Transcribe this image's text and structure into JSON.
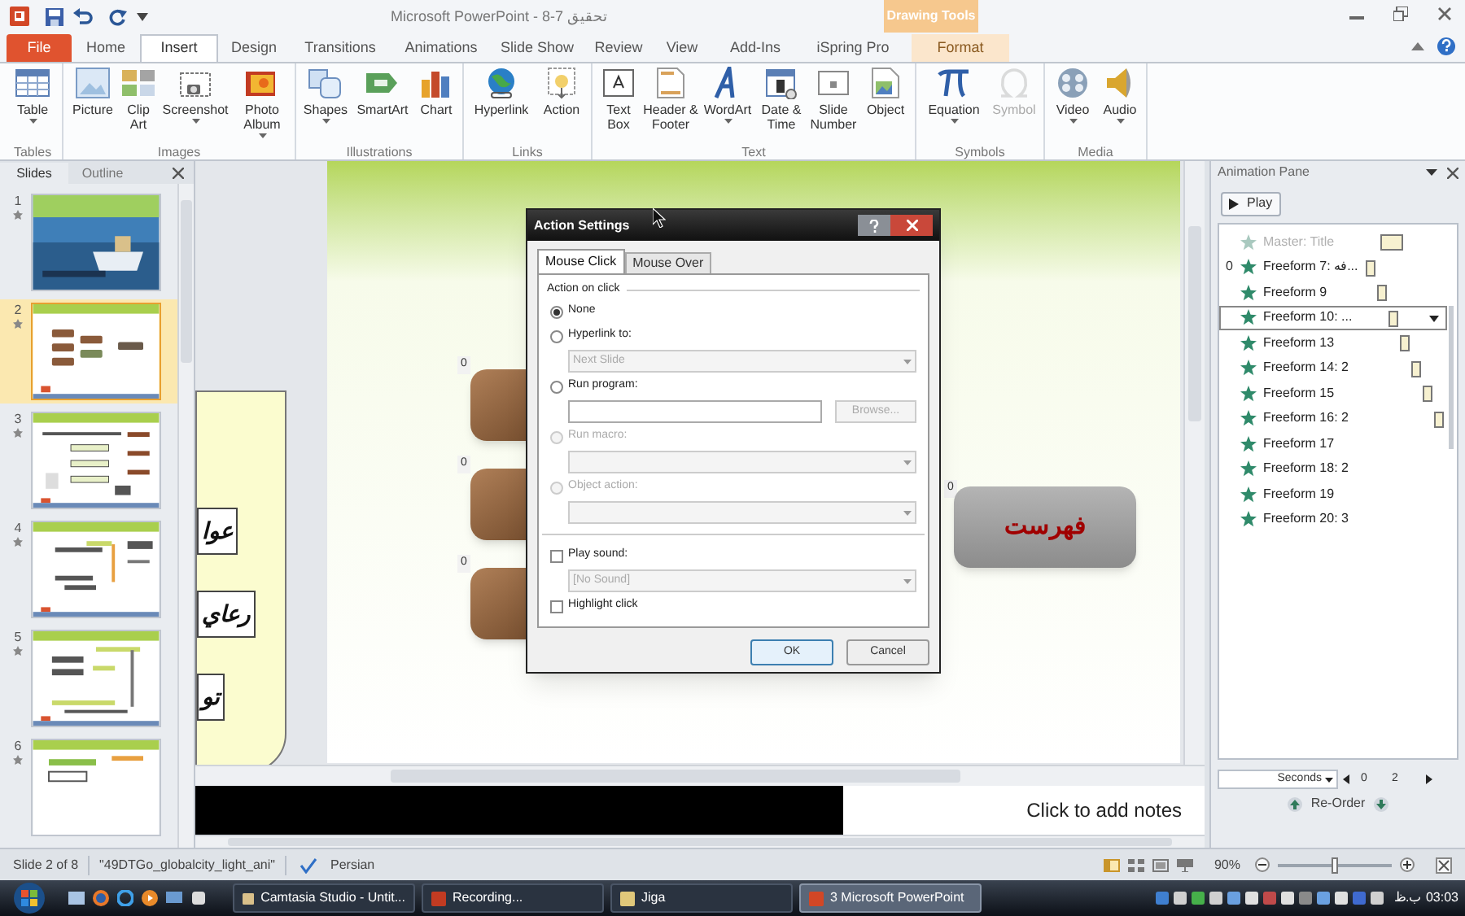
{
  "window": {
    "title": "تحقیق 7-8 - Microsoft PowerPoint",
    "contextual_tab": "Drawing Tools"
  },
  "ribbon_tabs": [
    {
      "label": "File",
      "kind": "file",
      "selected": false
    },
    {
      "label": "Home",
      "kind": "tab",
      "selected": false
    },
    {
      "label": "Insert",
      "kind": "tab",
      "selected": true
    },
    {
      "label": "Design",
      "kind": "tab",
      "selected": false
    },
    {
      "label": "Transitions",
      "kind": "tab",
      "selected": false
    },
    {
      "label": "Animations",
      "kind": "tab",
      "selected": false
    },
    {
      "label": "Slide Show",
      "kind": "tab",
      "selected": false
    },
    {
      "label": "Review",
      "kind": "tab",
      "selected": false
    },
    {
      "label": "View",
      "kind": "tab",
      "selected": false
    },
    {
      "label": "Add-Ins",
      "kind": "tab",
      "selected": false
    },
    {
      "label": "iSpring Pro",
      "kind": "tab",
      "selected": false
    },
    {
      "label": "Format",
      "kind": "contextual",
      "selected": false
    }
  ],
  "ribbon_groups": [
    {
      "label": "Tables",
      "buttons": [
        {
          "label": "Table",
          "dropdown": true,
          "disabled": false
        }
      ]
    },
    {
      "label": "Images",
      "buttons": [
        {
          "label": "Picture",
          "dropdown": false,
          "disabled": false
        },
        {
          "label": "Clip Art",
          "dropdown": false,
          "disabled": false
        },
        {
          "label": "Screenshot",
          "dropdown": true,
          "disabled": false
        },
        {
          "label": "Photo Album",
          "dropdown": true,
          "disabled": false
        }
      ]
    },
    {
      "label": "Illustrations",
      "buttons": [
        {
          "label": "Shapes",
          "dropdown": true,
          "disabled": false
        },
        {
          "label": "SmartArt",
          "dropdown": false,
          "disabled": false
        },
        {
          "label": "Chart",
          "dropdown": false,
          "disabled": false
        }
      ]
    },
    {
      "label": "Links",
      "buttons": [
        {
          "label": "Hyperlink",
          "dropdown": false,
          "disabled": false
        },
        {
          "label": "Action",
          "dropdown": false,
          "disabled": false
        }
      ]
    },
    {
      "label": "Text",
      "buttons": [
        {
          "label": "Text Box",
          "dropdown": false,
          "disabled": false
        },
        {
          "label": "Header & Footer",
          "dropdown": false,
          "disabled": false
        },
        {
          "label": "WordArt",
          "dropdown": true,
          "disabled": false
        },
        {
          "label": "Date & Time",
          "dropdown": false,
          "disabled": false
        },
        {
          "label": "Slide Number",
          "dropdown": false,
          "disabled": false
        },
        {
          "label": "Object",
          "dropdown": false,
          "disabled": false
        }
      ]
    },
    {
      "label": "Symbols",
      "buttons": [
        {
          "label": "Equation",
          "dropdown": true,
          "disabled": false
        },
        {
          "label": "Symbol",
          "dropdown": false,
          "disabled": true
        }
      ]
    },
    {
      "label": "Media",
      "buttons": [
        {
          "label": "Video",
          "dropdown": true,
          "disabled": false
        },
        {
          "label": "Audio",
          "dropdown": true,
          "disabled": false
        }
      ]
    }
  ],
  "slides_pane": {
    "tabs": [
      {
        "label": "Slides",
        "selected": true
      },
      {
        "label": "Outline",
        "selected": false
      }
    ],
    "slides": [
      {
        "number": "1",
        "selected": false
      },
      {
        "number": "2",
        "selected": true
      },
      {
        "number": "3",
        "selected": false
      },
      {
        "number": "4",
        "selected": false
      },
      {
        "number": "5",
        "selected": false
      },
      {
        "number": "6",
        "selected": false
      }
    ]
  },
  "slide": {
    "side_boxes": [
      "عوا",
      "رعاي",
      "تو"
    ],
    "buttons": [
      {
        "order": "0"
      },
      {
        "order": "0"
      },
      {
        "order": "0"
      }
    ],
    "menu_button": {
      "label": "فهرست",
      "order": "0"
    }
  },
  "notes": {
    "placeholder": "Click to add notes"
  },
  "dialog": {
    "title": "Action Settings",
    "tabs": [
      {
        "label": "Mouse Click",
        "selected": true
      },
      {
        "label": "Mouse Over",
        "selected": false
      }
    ],
    "section": "Action on click",
    "options": [
      {
        "kind": "radio",
        "label": "None",
        "selected": true,
        "disabled": false
      },
      {
        "kind": "radio",
        "label": "Hyperlink to:",
        "selected": false,
        "disabled": false
      },
      {
        "kind": "dropdown",
        "value": "Next Slide",
        "disabled": true
      },
      {
        "kind": "radio",
        "label": "Run program:",
        "selected": false,
        "disabled": false
      },
      {
        "kind": "browse",
        "button": "Browse...",
        "disabled": true
      },
      {
        "kind": "radio",
        "label": "Run macro:",
        "selected": false,
        "disabled": true
      },
      {
        "kind": "dropdown",
        "disabled": true
      },
      {
        "kind": "radio",
        "label": "Object action:",
        "selected": false,
        "disabled": true
      },
      {
        "kind": "dropdown",
        "disabled": true
      },
      {
        "kind": "separator"
      },
      {
        "kind": "checkbox",
        "label": "Play sound:",
        "checked": false,
        "disabled": false
      },
      {
        "kind": "dropdown",
        "value": "[No Sound]",
        "disabled": true
      },
      {
        "kind": "checkbox",
        "label": "Highlight click",
        "checked": false,
        "disabled": false
      }
    ],
    "buttons": [
      "OK",
      "Cancel"
    ]
  },
  "animation_pane": {
    "title": "Animation Pane",
    "play": "Play",
    "items": [
      {
        "label": "Master: Title",
        "disabled": true,
        "selected": false
      },
      {
        "label": "Freeform 7: فه...",
        "trigger": "0",
        "disabled": false,
        "selected": false
      },
      {
        "label": "Freeform 9",
        "disabled": false,
        "selected": false
      },
      {
        "label": "Freeform 10: ...",
        "disabled": false,
        "selected": true
      },
      {
        "label": "Freeform 13",
        "disabled": false,
        "selected": false
      },
      {
        "label": "Freeform 14: 2",
        "disabled": false,
        "selected": false
      },
      {
        "label": "Freeform 15",
        "disabled": false,
        "selected": false
      },
      {
        "label": "Freeform 16: 2",
        "disabled": false,
        "selected": false
      },
      {
        "label": "Freeform 17",
        "disabled": false,
        "selected": false
      },
      {
        "label": "Freeform 18: 2",
        "disabled": false,
        "selected": false
      },
      {
        "label": "Freeform 19",
        "disabled": false,
        "selected": false
      },
      {
        "label": "Freeform 20: 3",
        "disabled": false,
        "selected": false
      }
    ],
    "timeline_unit": "Seconds",
    "timeline_start": "0",
    "timeline_end": "2",
    "reorder": "Re-Order"
  },
  "status_bar": {
    "slide": "Slide 2 of 8",
    "theme": "\"49DTGo_globalcity_light_ani\"",
    "language": "Persian",
    "zoom": "90%",
    "zoom_slider": {
      "level": 0.5
    }
  },
  "taskbar": {
    "tasks": [
      {
        "label": "Camtasia Studio - Untit...",
        "selected": false
      },
      {
        "label": "Recording...",
        "selected": false
      },
      {
        "label": "Jiga",
        "selected": false
      },
      {
        "label": "3 Microsoft PowerPoint",
        "selected": true
      }
    ],
    "clock": "03:03 ب.ظ"
  }
}
